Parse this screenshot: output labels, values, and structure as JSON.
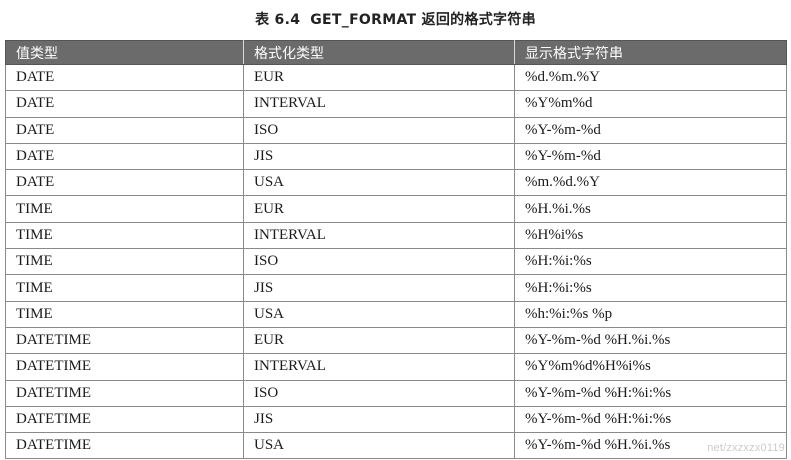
{
  "caption": {
    "label": "表 6.4",
    "title": "GET_FORMAT 返回的格式字符串"
  },
  "table": {
    "headers": [
      "值类型",
      "格式化类型",
      "显示格式字符串"
    ],
    "rows": [
      [
        "DATE",
        "EUR",
        "%d.%m.%Y"
      ],
      [
        "DATE",
        "INTERVAL",
        "%Y%m%d"
      ],
      [
        "DATE",
        "ISO",
        "%Y-%m-%d"
      ],
      [
        "DATE",
        "JIS",
        "%Y-%m-%d"
      ],
      [
        "DATE",
        "USA",
        "%m.%d.%Y"
      ],
      [
        "TIME",
        "EUR",
        "%H.%i.%s"
      ],
      [
        "TIME",
        "INTERVAL",
        "%H%i%s"
      ],
      [
        "TIME",
        "ISO",
        "%H:%i:%s"
      ],
      [
        "TIME",
        "JIS",
        "%H:%i:%s"
      ],
      [
        "TIME",
        "USA",
        "%h:%i:%s %p"
      ],
      [
        "DATETIME",
        "EUR",
        "%Y-%m-%d %H.%i.%s"
      ],
      [
        "DATETIME",
        "INTERVAL",
        "%Y%m%d%H%i%s"
      ],
      [
        "DATETIME",
        "ISO",
        "%Y-%m-%d %H:%i:%s"
      ],
      [
        "DATETIME",
        "JIS",
        "%Y-%m-%d %H:%i:%s"
      ],
      [
        "DATETIME",
        "USA",
        "%Y-%m-%d %H.%i.%s"
      ]
    ]
  },
  "watermark": "net/zxzxzx0119"
}
